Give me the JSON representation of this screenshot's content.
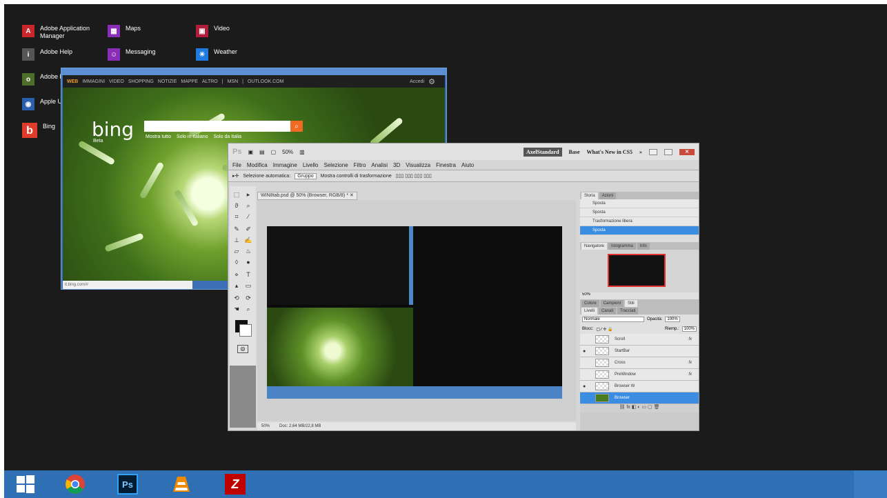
{
  "start_tiles": [
    {
      "label": "Adobe Application Manager",
      "icon": "adobe-icon",
      "color": "#c8262b"
    },
    {
      "label": "Adobe Help",
      "icon": "info-icon",
      "color": "#555555"
    },
    {
      "label": "Adobe Browse",
      "icon": "adobe-bridge-icon",
      "color": "#4e6f2c"
    },
    {
      "label": "Apple Update",
      "icon": "apple-update-icon",
      "color": "#2a5fae"
    },
    {
      "label": "Bing",
      "icon": "bing-icon",
      "color": "#e03c2b"
    },
    {
      "label": "Maps",
      "icon": "maps-icon",
      "color": "#8a2eb8"
    },
    {
      "label": "Messaging",
      "icon": "messaging-icon",
      "color": "#8a2eb8"
    },
    {
      "label": "Video",
      "icon": "video-icon",
      "color": "#b01e3b"
    },
    {
      "label": "Weather",
      "icon": "weather-icon",
      "color": "#1f7be0"
    }
  ],
  "bing": {
    "nav": [
      "WEB",
      "IMMAGINI",
      "VIDEO",
      "SHOPPING",
      "NOTIZIE",
      "MAPPE",
      "ALTRO",
      "|",
      "MSN",
      "|",
      "OUTLOOK.COM"
    ],
    "signin": "Accedi",
    "logo": "bing",
    "beta": "Beta",
    "radios": [
      "Mostra tutto",
      "Solo in italiano",
      "Solo da Italia"
    ],
    "status": "it.bing.com/#"
  },
  "ps": {
    "logo": "Ps",
    "zoom": "50%",
    "workspaces": [
      "AxelStandard",
      "Base",
      "What's New in CS5"
    ],
    "menu": [
      "File",
      "Modifica",
      "Immagine",
      "Livello",
      "Selezione",
      "Filtro",
      "Analisi",
      "3D",
      "Visualizza",
      "Finestra",
      "Aiuto"
    ],
    "options": {
      "auto_select": "Selezione automatica:",
      "group": "Gruppo",
      "transform": "Mostra controlli di trasformazione"
    },
    "doc_tab": "WIN8tab.psd @ 50% (Browser, RGB/8) *",
    "status_zoom": "50%",
    "status_doc": "Doc: 2,64 MB/22,8 MB",
    "history_tabs": [
      "Storia",
      "Azioni"
    ],
    "history": [
      "Sposta",
      "Sposta",
      "Trasformazione libera",
      "Sposta"
    ],
    "nav_tabs": [
      "Navigatore",
      "Istogramma",
      "Info"
    ],
    "nav_zoom": "50%",
    "color_tabs": [
      "Colore",
      "Campioni",
      "Stili"
    ],
    "layer_tabs": [
      "Livelli",
      "Canali",
      "Tracciati"
    ],
    "blend": "Normale",
    "opacity_label": "Opacità:",
    "opacity": "100%",
    "lock_label": "Blocc:",
    "fill_label": "Riemp.:",
    "fill": "100%",
    "layers": [
      {
        "name": "Scroll",
        "fx": true
      },
      {
        "name": "StartBar",
        "fx": false
      },
      {
        "name": "Cross",
        "fx": true
      },
      {
        "name": "PreWindow",
        "fx": true
      },
      {
        "name": "Browser W",
        "fx": false
      },
      {
        "name": "Browser",
        "fx": false
      }
    ]
  },
  "taskbar": [
    "windows-logo-icon",
    "chrome-icon",
    "photoshop-icon",
    "vlc-icon",
    "filezilla-icon"
  ]
}
